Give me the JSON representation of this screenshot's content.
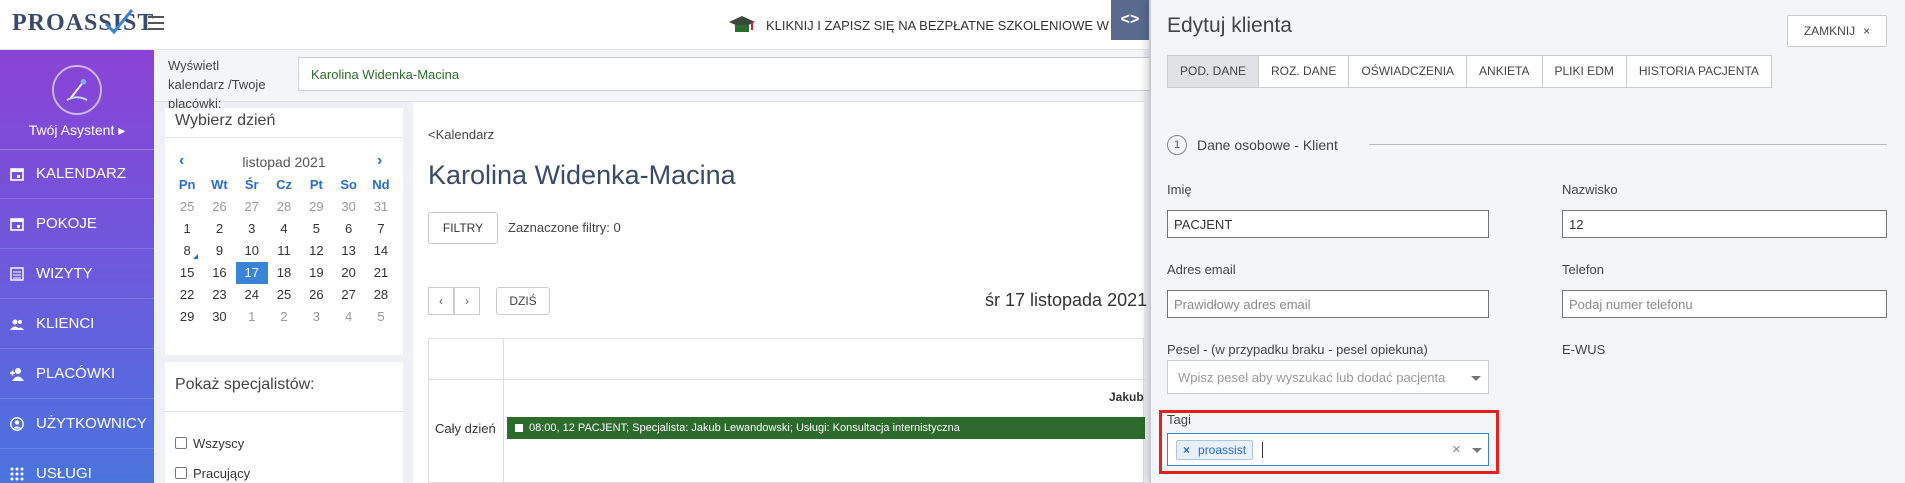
{
  "brand": {
    "logo_text": "PROASSIST"
  },
  "promo": {
    "text": "KLIKNIJ I ZAPISZ SIĘ NA BEZPŁATNE SZKOLENIOWE W"
  },
  "collapse_toggle": "<>",
  "sidebar": {
    "assistant_label": "Twój Asystent ▸",
    "items": [
      {
        "label": "KALENDARZ",
        "icon": "calendar-icon"
      },
      {
        "label": "POKOJE",
        "icon": "calendar-icon"
      },
      {
        "label": "WIZYTY",
        "icon": "list-icon"
      },
      {
        "label": "KLIENCI",
        "icon": "users-icon"
      },
      {
        "label": "PLACÓWKI",
        "icon": "add-user-icon"
      },
      {
        "label": "UŻYTKOWNICY",
        "icon": "user-circle-icon"
      },
      {
        "label": "USŁUGI",
        "icon": "grid-icon"
      }
    ]
  },
  "filterbar": {
    "label": "Wyświetl kalendarz /Twoje placówki:",
    "value": "Karolina Widenka-Macina"
  },
  "daypicker": {
    "title": "Wybierz dzień",
    "month": "listopad 2021",
    "prev": "‹",
    "next": "›",
    "weekdays": [
      "Pn",
      "Wt",
      "Śr",
      "Cz",
      "Pt",
      "So",
      "Nd"
    ],
    "weeks": [
      [
        "25",
        "26",
        "27",
        "28",
        "29",
        "30",
        "31"
      ],
      [
        "1",
        "2",
        "3",
        "4",
        "5",
        "6",
        "7"
      ],
      [
        "8",
        "9",
        "10",
        "11",
        "12",
        "13",
        "14"
      ],
      [
        "15",
        "16",
        "17",
        "18",
        "19",
        "20",
        "21"
      ],
      [
        "22",
        "23",
        "24",
        "25",
        "26",
        "27",
        "28"
      ],
      [
        "29",
        "30",
        "1",
        "2",
        "3",
        "4",
        "5"
      ]
    ],
    "selected": "17"
  },
  "specialists": {
    "title": "Pokaż specjalistów:",
    "options": [
      "Wszyscy",
      "Pracujący"
    ]
  },
  "calendar": {
    "back_link": "<Kalendarz",
    "title": "Karolina Widenka-Macina",
    "filters_button": "FILTRY",
    "filters_note": "Zaznaczone filtry: 0",
    "prev": "‹",
    "next": "›",
    "today_button": "DZIŚ",
    "date_heading": "śr 17 listopada 2021",
    "doctor_header": "Jakub",
    "allday_label": "Cały dzień",
    "event_text": "08:00, 12 PACJENT; Specjalista: Jakub Lewandowski; Usługi: Konsultacja internistyczna"
  },
  "edit_client": {
    "title": "Edytuj klienta",
    "close_label": "ZAMKNIJ",
    "close_icon": "×",
    "tabs": [
      "POD. DANE",
      "ROZ. DANE",
      "OŚWIADCZENIA",
      "ANKIETA",
      "PLIKI EDM",
      "HISTORIA PACJENTA"
    ],
    "section_number": "1",
    "section_title": "Dane osobowe - Klient",
    "first_name_label": "Imię",
    "first_name_value": "PACJENT",
    "last_name_label": "Nazwisko",
    "last_name_value": "12",
    "email_label": "Adres email",
    "email_placeholder": "Prawidłowy adres email",
    "phone_label": "Telefon",
    "phone_placeholder": "Podaj numer telefonu",
    "pesel_label": "Pesel - (w przypadku braku - pesel opiekuna)",
    "pesel_placeholder": "Wpisz pesel aby wyszukać lub dodać pacjenta",
    "ewus_label": "E-WUS",
    "tags_label": "Tagi",
    "tags": [
      "proassist"
    ],
    "tag_remove": "×",
    "tags_clear": "×"
  }
}
